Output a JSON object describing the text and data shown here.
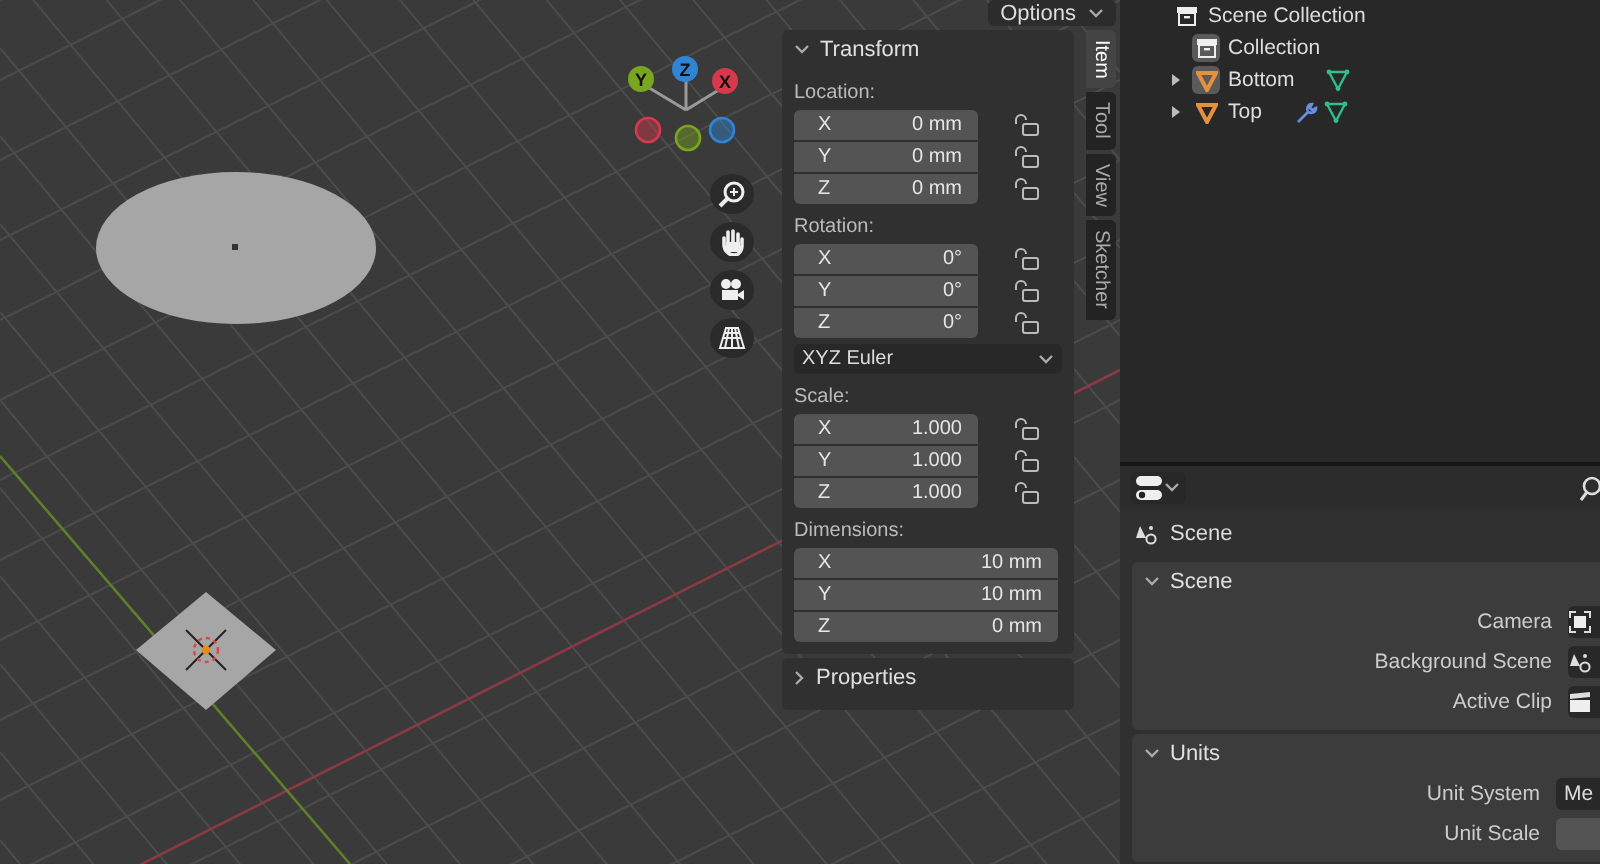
{
  "viewport": {
    "options_button": "Options",
    "gizmo_axes": [
      {
        "label": "Y",
        "color": "#7aa520"
      },
      {
        "label": "Z",
        "color": "#2f84d6"
      },
      {
        "label": "X",
        "color": "#d6384c"
      }
    ],
    "sidebar_tabs": [
      {
        "label": "Item",
        "selected": true
      },
      {
        "label": "Tool",
        "selected": false
      },
      {
        "label": "View",
        "selected": false
      },
      {
        "label": "Sketcher",
        "selected": false
      }
    ],
    "panels": [
      {
        "title": "Transform",
        "expanded": true,
        "sections": [
          {
            "kind": "vector",
            "label": "Location:",
            "fields": [
              {
                "axis": "X",
                "value": "0 mm",
                "locked": false
              },
              {
                "axis": "Y",
                "value": "0 mm",
                "locked": false
              },
              {
                "axis": "Z",
                "value": "0 mm",
                "locked": false
              }
            ]
          },
          {
            "kind": "vector",
            "label": "Rotation:",
            "fields": [
              {
                "axis": "X",
                "value": "0°",
                "locked": false
              },
              {
                "axis": "Y",
                "value": "0°",
                "locked": false
              },
              {
                "axis": "Z",
                "value": "0°",
                "locked": false
              }
            ]
          },
          {
            "kind": "dropdown",
            "value": "XYZ Euler"
          },
          {
            "kind": "vector",
            "label": "Scale:",
            "fields": [
              {
                "axis": "X",
                "value": "1.000",
                "locked": false
              },
              {
                "axis": "Y",
                "value": "1.000",
                "locked": false
              },
              {
                "axis": "Z",
                "value": "1.000",
                "locked": false
              }
            ]
          },
          {
            "kind": "vector",
            "label": "Dimensions:",
            "fields": [
              {
                "axis": "X",
                "value": "10 mm"
              },
              {
                "axis": "Y",
                "value": "10 mm"
              },
              {
                "axis": "Z",
                "value": "0 mm"
              }
            ]
          }
        ]
      },
      {
        "title": "Properties",
        "expanded": false
      }
    ]
  },
  "outliner": {
    "items": [
      {
        "label": "Scene Collection",
        "kind": "collection",
        "active": false,
        "children": [
          {
            "label": "Collection",
            "kind": "collection",
            "active": true
          },
          {
            "label": "Bottom",
            "kind": "object",
            "active": true,
            "expanded": false,
            "modifier": false
          },
          {
            "label": "Top",
            "kind": "object",
            "active": false,
            "expanded": false,
            "modifier": true
          }
        ]
      }
    ]
  },
  "properties": {
    "breadcrumb": "Scene",
    "panels": [
      {
        "title": "Scene",
        "expanded": true,
        "rows": [
          {
            "label": "Camera",
            "kind": "camera"
          },
          {
            "label": "Background Scene",
            "kind": "scene"
          },
          {
            "label": "Active Clip",
            "kind": "clip"
          }
        ]
      },
      {
        "title": "Units",
        "expanded": true,
        "rows": [
          {
            "label": "Unit System",
            "kind": "dropdown",
            "value": "Me"
          },
          {
            "label": "Unit Scale",
            "kind": "number"
          }
        ]
      }
    ]
  }
}
